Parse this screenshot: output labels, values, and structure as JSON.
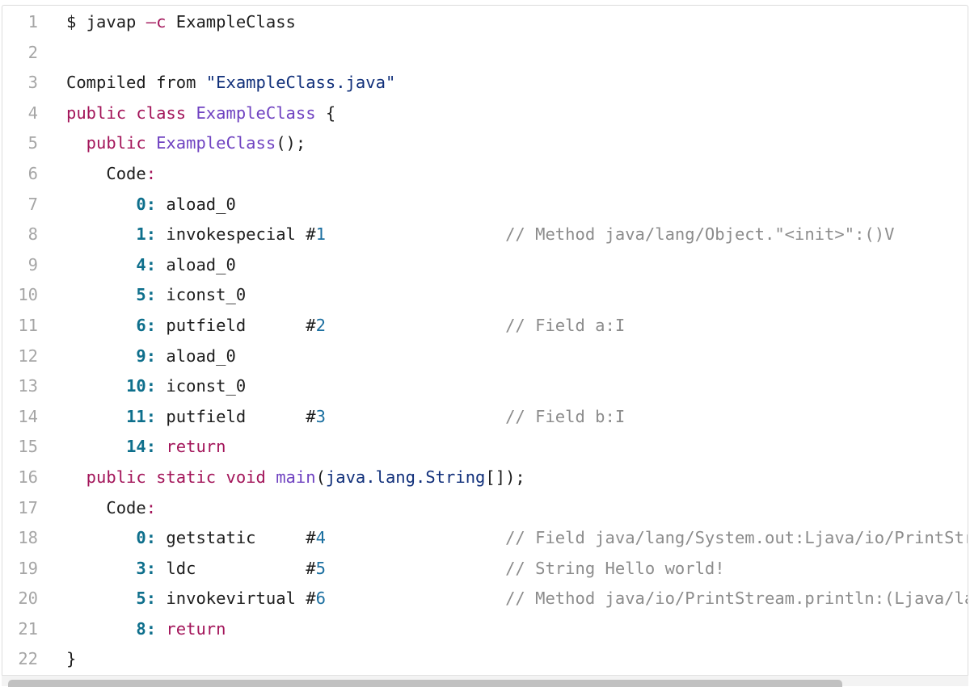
{
  "editor": {
    "lines": [
      {
        "n": "1",
        "tokens": [
          {
            "t": "$ javap ",
            "c": "pl"
          },
          {
            "t": "–c",
            "c": "kw"
          },
          {
            "t": " ExampleClass",
            "c": "pl"
          }
        ]
      },
      {
        "n": "2",
        "tokens": []
      },
      {
        "n": "3",
        "tokens": [
          {
            "t": "Compiled from ",
            "c": "pl"
          },
          {
            "t": "\"ExampleClass.java\"",
            "c": "str"
          }
        ]
      },
      {
        "n": "4",
        "tokens": [
          {
            "t": "public class ",
            "c": "kw"
          },
          {
            "t": "ExampleClass",
            "c": "ty"
          },
          {
            "t": " {",
            "c": "pl"
          }
        ]
      },
      {
        "n": "5",
        "tokens": [
          {
            "t": "  public ",
            "c": "kw"
          },
          {
            "t": "ExampleClass",
            "c": "ty"
          },
          {
            "t": "();",
            "c": "pl"
          }
        ]
      },
      {
        "n": "6",
        "tokens": [
          {
            "t": "    Code",
            "c": "pl"
          },
          {
            "t": ":",
            "c": "lbl"
          }
        ]
      },
      {
        "n": "7",
        "tokens": [
          {
            "t": "       ",
            "c": "pl"
          },
          {
            "t": "0:",
            "c": "num"
          },
          {
            "t": " aload_0",
            "c": "pl"
          }
        ]
      },
      {
        "n": "8",
        "tokens": [
          {
            "t": "       ",
            "c": "pl"
          },
          {
            "t": "1:",
            "c": "num"
          },
          {
            "t": " invokespecial ",
            "c": "pl"
          },
          {
            "t": "#",
            "c": "pl"
          },
          {
            "t": "1",
            "c": "cls"
          },
          {
            "t": "                  ",
            "c": "pl"
          },
          {
            "t": "// Method java/lang/Object.\"<init>\":()V",
            "c": "cm"
          }
        ]
      },
      {
        "n": "9",
        "tokens": [
          {
            "t": "       ",
            "c": "pl"
          },
          {
            "t": "4:",
            "c": "num"
          },
          {
            "t": " aload_0",
            "c": "pl"
          }
        ]
      },
      {
        "n": "10",
        "tokens": [
          {
            "t": "       ",
            "c": "pl"
          },
          {
            "t": "5:",
            "c": "num"
          },
          {
            "t": " iconst_0",
            "c": "pl"
          }
        ]
      },
      {
        "n": "11",
        "tokens": [
          {
            "t": "       ",
            "c": "pl"
          },
          {
            "t": "6:",
            "c": "num"
          },
          {
            "t": " putfield      ",
            "c": "pl"
          },
          {
            "t": "#",
            "c": "pl"
          },
          {
            "t": "2",
            "c": "cls"
          },
          {
            "t": "                  ",
            "c": "pl"
          },
          {
            "t": "// Field a:I",
            "c": "cm"
          }
        ]
      },
      {
        "n": "12",
        "tokens": [
          {
            "t": "       ",
            "c": "pl"
          },
          {
            "t": "9:",
            "c": "num"
          },
          {
            "t": " aload_0",
            "c": "pl"
          }
        ]
      },
      {
        "n": "13",
        "tokens": [
          {
            "t": "      ",
            "c": "pl"
          },
          {
            "t": "10:",
            "c": "num"
          },
          {
            "t": " iconst_0",
            "c": "pl"
          }
        ]
      },
      {
        "n": "14",
        "tokens": [
          {
            "t": "      ",
            "c": "pl"
          },
          {
            "t": "11:",
            "c": "num"
          },
          {
            "t": " putfield      ",
            "c": "pl"
          },
          {
            "t": "#",
            "c": "pl"
          },
          {
            "t": "3",
            "c": "cls"
          },
          {
            "t": "                  ",
            "c": "pl"
          },
          {
            "t": "// Field b:I",
            "c": "cm"
          }
        ]
      },
      {
        "n": "15",
        "tokens": [
          {
            "t": "      ",
            "c": "pl"
          },
          {
            "t": "14:",
            "c": "num"
          },
          {
            "t": " return",
            "c": "kw"
          }
        ]
      },
      {
        "n": "16",
        "tokens": [
          {
            "t": "  public static void ",
            "c": "kw"
          },
          {
            "t": "main",
            "c": "ty"
          },
          {
            "t": "(",
            "c": "pl"
          },
          {
            "t": "java.lang.String",
            "c": "str"
          },
          {
            "t": "[]);",
            "c": "pl"
          }
        ]
      },
      {
        "n": "17",
        "tokens": [
          {
            "t": "    Code",
            "c": "pl"
          },
          {
            "t": ":",
            "c": "lbl"
          }
        ]
      },
      {
        "n": "18",
        "tokens": [
          {
            "t": "       ",
            "c": "pl"
          },
          {
            "t": "0:",
            "c": "num"
          },
          {
            "t": " getstatic     ",
            "c": "pl"
          },
          {
            "t": "#",
            "c": "pl"
          },
          {
            "t": "4",
            "c": "cls"
          },
          {
            "t": "                  ",
            "c": "pl"
          },
          {
            "t": "// Field java/lang/System.out:Ljava/io/PrintStr",
            "c": "cm"
          }
        ]
      },
      {
        "n": "19",
        "tokens": [
          {
            "t": "       ",
            "c": "pl"
          },
          {
            "t": "3:",
            "c": "num"
          },
          {
            "t": " ldc           ",
            "c": "pl"
          },
          {
            "t": "#",
            "c": "pl"
          },
          {
            "t": "5",
            "c": "cls"
          },
          {
            "t": "                  ",
            "c": "pl"
          },
          {
            "t": "// String Hello world!",
            "c": "cm"
          }
        ]
      },
      {
        "n": "20",
        "tokens": [
          {
            "t": "       ",
            "c": "pl"
          },
          {
            "t": "5:",
            "c": "num"
          },
          {
            "t": " invokevirtual ",
            "c": "pl"
          },
          {
            "t": "#",
            "c": "pl"
          },
          {
            "t": "6",
            "c": "cls"
          },
          {
            "t": "                  ",
            "c": "pl"
          },
          {
            "t": "// Method java/io/PrintStream.println:(Ljava/la",
            "c": "cm"
          }
        ]
      },
      {
        "n": "21",
        "tokens": [
          {
            "t": "       ",
            "c": "pl"
          },
          {
            "t": "8:",
            "c": "num"
          },
          {
            "t": " return",
            "c": "kw"
          }
        ]
      },
      {
        "n": "22",
        "tokens": [
          {
            "t": "}",
            "c": "pl"
          }
        ]
      }
    ]
  },
  "colors": {
    "keyword": "#a3155a",
    "type": "#6f42c1",
    "string": "#102f7a",
    "offset": "#0e6f8c",
    "comment": "#8c8c8c",
    "line_number": "#a6a6a6"
  },
  "scrollbar": {
    "position": 0.0,
    "visible_fraction": 0.87
  }
}
